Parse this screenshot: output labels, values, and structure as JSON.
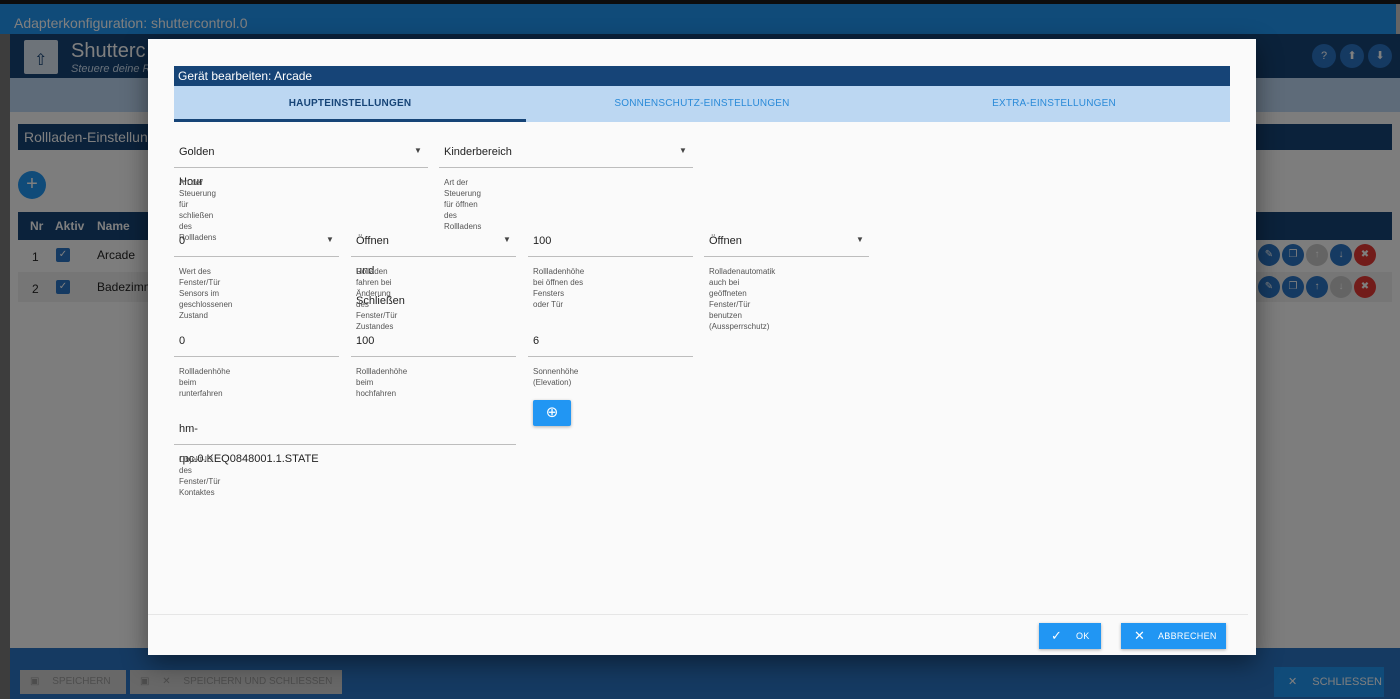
{
  "window": {
    "title": "Adapterkonfiguration: shuttercontrol.0"
  },
  "app": {
    "name": "Shutterc",
    "subtitle": "Steuere deine R",
    "header_icons": [
      "help-icon",
      "upload-icon",
      "download-icon"
    ],
    "section_title": "Rollladen-Einstellun",
    "add_label": "+",
    "table": {
      "headers": [
        "Nr",
        "Aktiv",
        "Name"
      ],
      "rows": [
        {
          "nr": "1",
          "active": true,
          "name": "Arcade"
        },
        {
          "nr": "2",
          "active": true,
          "name": "Badezimm"
        }
      ]
    },
    "footer": {
      "save": "SPEICHERN",
      "save_close": "SPEICHERN UND SCHLIESSEN",
      "close": "SCHLIESSEN"
    }
  },
  "dialog": {
    "title": "Gerät bearbeiten: Arcade",
    "tabs": [
      {
        "label": "HAUPTEINSTELLUNGEN",
        "active": true
      },
      {
        "label": "SONNENSCHUTZ-EINSTELLUNGEN",
        "active": false
      },
      {
        "label": "EXTRA-EINSTELLUNGEN",
        "active": false
      }
    ],
    "fields": {
      "close_mode": {
        "value": "Golden Hour",
        "hint": "Art der Steuerung für schließen des Rollladens"
      },
      "open_mode": {
        "value": "Kinderbereich",
        "hint": "Art der Steuerung für öffnen des Rollladens"
      },
      "sensor_closed": {
        "value": "0",
        "hint1": "Wert des Fenster/Tür Sensors im",
        "hint2": "geschlossenen Zustand"
      },
      "move_on_change": {
        "value": "Öffnen und Schließen",
        "hint1": "Rolladen fahren bei Änderung des",
        "hint2": "Fenster/Tür Zustandes"
      },
      "height_on_open": {
        "value": "100",
        "hint1": "Rollladenhöhe bei öffnen des Fensters",
        "hint2": "oder Tür"
      },
      "lockout": {
        "value": "Öffnen",
        "hint1": "Rolladenautomatik auch bei geöffneten",
        "hint2": "Fenster/Tür benutzen (Aussperrschutz)"
      },
      "height_down": {
        "value": "0",
        "hint": "Rollladenhöhe beim runterfahren"
      },
      "height_up": {
        "value": "100",
        "hint": "Rollladenhöhe beim hochfahren"
      },
      "elevation": {
        "value": "6",
        "hint": "Sonnenhöhe (Elevation)"
      },
      "contact_id": {
        "value": "hm-rpc.0.KEQ0848001.1.STATE",
        "hint": "Objekt-ID des Fenster/Tür Kontaktes"
      }
    },
    "buttons": {
      "ok": "OK",
      "cancel": "ABBRECHEN"
    }
  },
  "colors": {
    "primary": "#2196f3",
    "dark": "#164477",
    "tab_bg": "#bcd7f2",
    "danger": "#e53935"
  }
}
